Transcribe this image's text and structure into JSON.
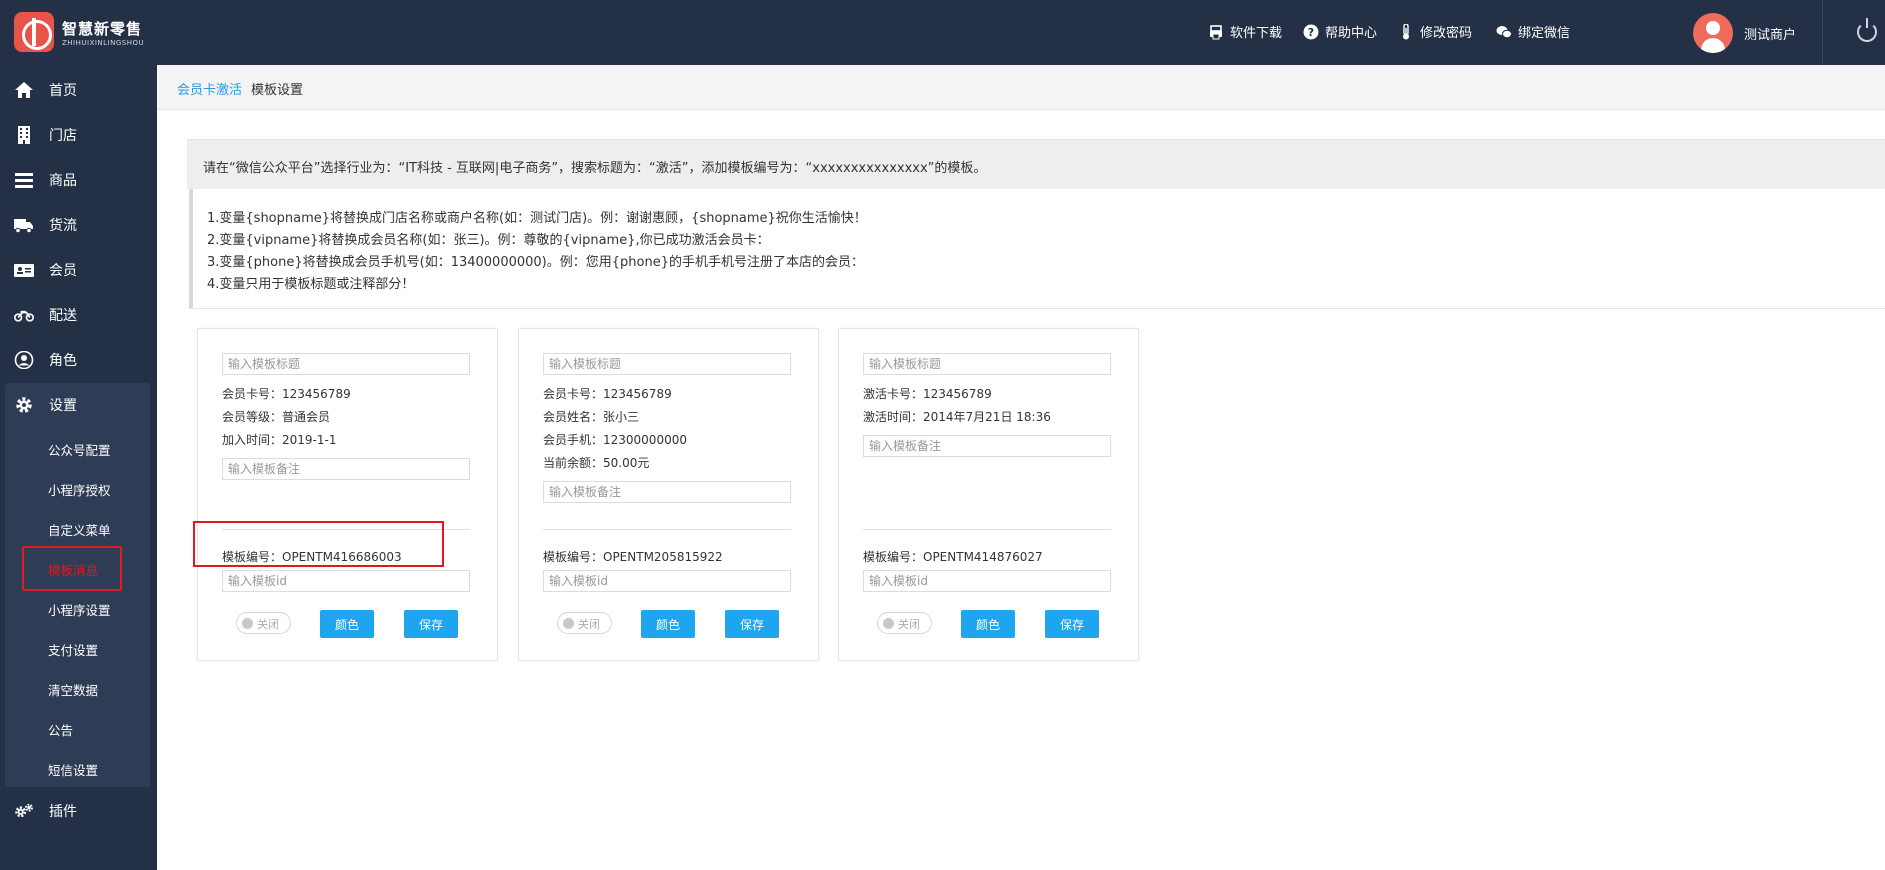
{
  "logo": {
    "cn": "智慧新零售",
    "en": "ZHIHUIXINLINGSHOU"
  },
  "header": {
    "links": [
      {
        "label": "软件下载",
        "icon": "software-download-icon"
      },
      {
        "label": "帮助中心",
        "icon": "help-icon"
      },
      {
        "label": "修改密码",
        "icon": "thermometer-icon"
      },
      {
        "label": "绑定微信",
        "icon": "wechat-icon"
      }
    ],
    "user_name": "测试商户"
  },
  "sidebar": {
    "items": [
      {
        "label": "首页",
        "icon": "home-icon"
      },
      {
        "label": "门店",
        "icon": "building-icon"
      },
      {
        "label": "商品",
        "icon": "list-icon"
      },
      {
        "label": "货流",
        "icon": "truck-icon"
      },
      {
        "label": "会员",
        "icon": "id-card-icon"
      },
      {
        "label": "配送",
        "icon": "motorcycle-icon"
      },
      {
        "label": "角色",
        "icon": "user-circle-icon"
      },
      {
        "label": "设置",
        "icon": "gear-icon"
      },
      {
        "label": "插件",
        "icon": "gears-icon"
      }
    ],
    "settings_sub": [
      "公众号配置",
      "小程序授权",
      "自定义菜单",
      "模板消息",
      "小程序设置",
      "支付设置",
      "清空数据",
      "公告",
      "短信设置"
    ],
    "active_sub": "模板消息",
    "active_color": "#e0191e"
  },
  "breadcrumb": {
    "link": "会员卡激活",
    "current": "模板设置"
  },
  "notice": "请在“微信公众平台”选择行业为：“IT科技 - 互联网|电子商务”，搜索标题为：“激活”，添加模板编号为：“xxxxxxxxxxxxxxx”的模板。",
  "rules": [
    "1.变量{shopname}将替换成门店名称或商户名称(如：测试门店)。例：谢谢惠顾，{shopname}祝你生活愉快！",
    "2.变量{vipname}将替换成会员名称(如：张三)。例：尊敬的{vipname},你已成功激活会员卡：",
    "3.变量{phone}将替换成会员手机号(如：13400000000)。例：您用{phone}的手机手机号注册了本店的会员：",
    "4.变量只用于模板标题或注释部分！"
  ],
  "cards": [
    {
      "title_placeholder": "输入模板标题",
      "lines": [
        "会员卡号：123456789",
        "会员等级：普通会员",
        "加入时间：2019-1-1"
      ],
      "note_placeholder": "输入模板备注",
      "template_no": "模板编号：OPENTM416686003",
      "id_placeholder": "输入模板id",
      "toggle": "关闭",
      "color_btn": "颜色",
      "save_btn": "保存"
    },
    {
      "title_placeholder": "输入模板标题",
      "lines": [
        "会员卡号：123456789",
        "会员姓名：张小三",
        "会员手机：12300000000",
        "当前余额：50.00元"
      ],
      "note_placeholder": "输入模板备注",
      "template_no": "模板编号：OPENTM205815922",
      "id_placeholder": "输入模板id",
      "toggle": "关闭",
      "color_btn": "颜色",
      "save_btn": "保存"
    },
    {
      "title_placeholder": "输入模板标题",
      "lines": [
        "激活卡号：123456789",
        "激活时间：2014年7月21日 18:36"
      ],
      "note_placeholder": "输入模板备注",
      "template_no": "模板编号：OPENTM414876027",
      "id_placeholder": "输入模板id",
      "toggle": "关闭",
      "color_btn": "颜色",
      "save_btn": "保存"
    }
  ],
  "colors": {
    "topbar": "#233046",
    "accent": "#1fa4ef",
    "link": "#2a9be0",
    "highlight": "#e0191e"
  }
}
